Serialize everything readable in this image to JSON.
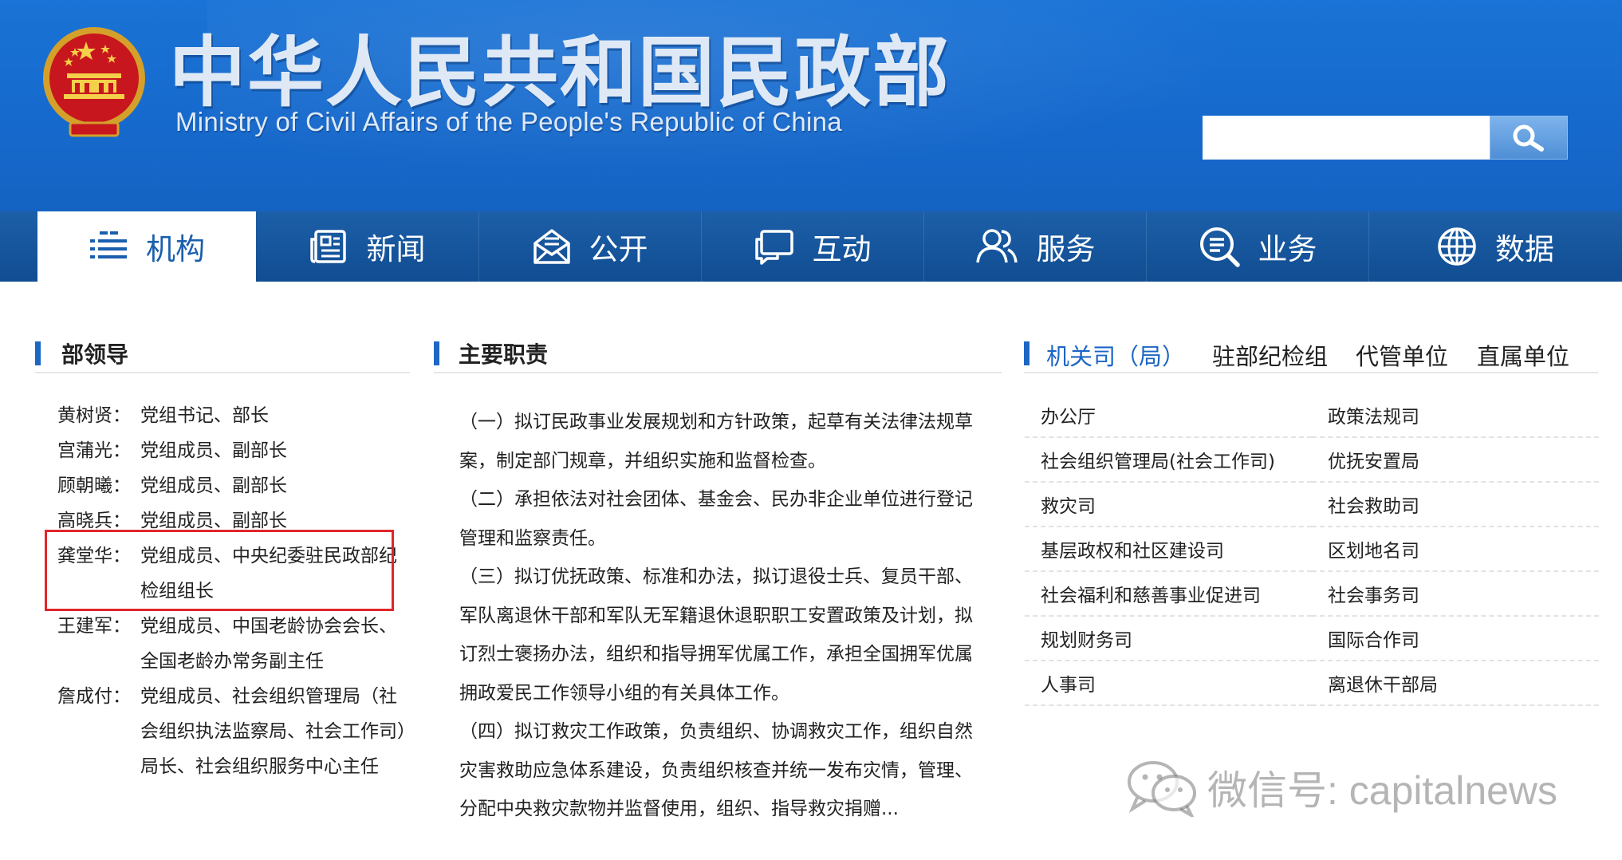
{
  "header": {
    "title_cn": "中华人民共和国民政部",
    "title_en": "Ministry of Civil Affairs of the People's Republic of China",
    "search": {
      "placeholder": "",
      "icon": "search-icon"
    },
    "colors": {
      "primary": "#1a73d6",
      "nav": "#1c5fa8",
      "accent": "#1c66c4",
      "highlight": "#e0262b"
    }
  },
  "nav": {
    "items": [
      {
        "label": "机构",
        "icon": "org-list-icon"
      },
      {
        "label": "新闻",
        "icon": "news-icon"
      },
      {
        "label": "公开",
        "icon": "mail-icon"
      },
      {
        "label": "互动",
        "icon": "chat-icon"
      },
      {
        "label": "服务",
        "icon": "people-icon"
      },
      {
        "label": "业务",
        "icon": "search-doc-icon"
      },
      {
        "label": "数据",
        "icon": "globe-icon"
      }
    ],
    "active_index": 0
  },
  "leaders": {
    "title": "部领导",
    "items": [
      {
        "name": "黄树贤：",
        "role": "党组书记、部长"
      },
      {
        "name": "宫蒲光：",
        "role": "党组成员、副部长"
      },
      {
        "name": "顾朝曦：",
        "role": "党组成员、副部长"
      },
      {
        "name": "高晓兵：",
        "role": "党组成员、副部长"
      },
      {
        "name": "龚堂华：",
        "role": "党组成员、中央纪委驻民政部纪检组组长"
      },
      {
        "name": "王建军：",
        "role": "党组成员、中国老龄协会会长、全国老龄办常务副主任"
      },
      {
        "name": "詹成付：",
        "role": "党组成员、社会组织管理局（社会组织执法监察局、社会工作司）局长、社会组织服务中心主任"
      }
    ]
  },
  "duties": {
    "title": "主要职责",
    "paragraphs": [
      "（一）拟订民政事业发展规划和方针政策，起草有关法律法规草案，制定部门规章，并组织实施和监督检查。",
      "（二）承担依法对社会团体、基金会、民办非企业单位进行登记管理和监察责任。",
      "（三）拟订优抚政策、标准和办法，拟订退役士兵、复员干部、军队离退休干部和军队无军籍退休退职职工安置政策及计划，拟订烈士褒扬办法，组织和指导拥军优属工作，承担全国拥军优属拥政爱民工作领导小组的有关具体工作。",
      "（四）拟订救灾工作政策，负责组织、协调救灾工作，组织自然灾害救助应急体系建设，负责组织核查并统一发布灾情，管理、分配中央救灾款物并监督使用，组织、指导救灾捐赠..."
    ]
  },
  "departments": {
    "tabs": [
      "机关司（局）",
      "驻部纪检组",
      "代管单位",
      "直属单位"
    ],
    "active_tab": 0,
    "rows": [
      [
        "办公厅",
        "政策法规司"
      ],
      [
        "社会组织管理局(社会工作司)",
        "优抚安置局"
      ],
      [
        "救灾司",
        "社会救助司"
      ],
      [
        "基层政权和社区建设司",
        "区划地名司"
      ],
      [
        "社会福利和慈善事业促进司",
        "社会事务司"
      ],
      [
        "规划财务司",
        "国际合作司"
      ],
      [
        "人事司",
        "离退休干部局"
      ]
    ]
  },
  "watermark": {
    "text": "微信号: capitalnews",
    "icon": "wechat-icon"
  }
}
